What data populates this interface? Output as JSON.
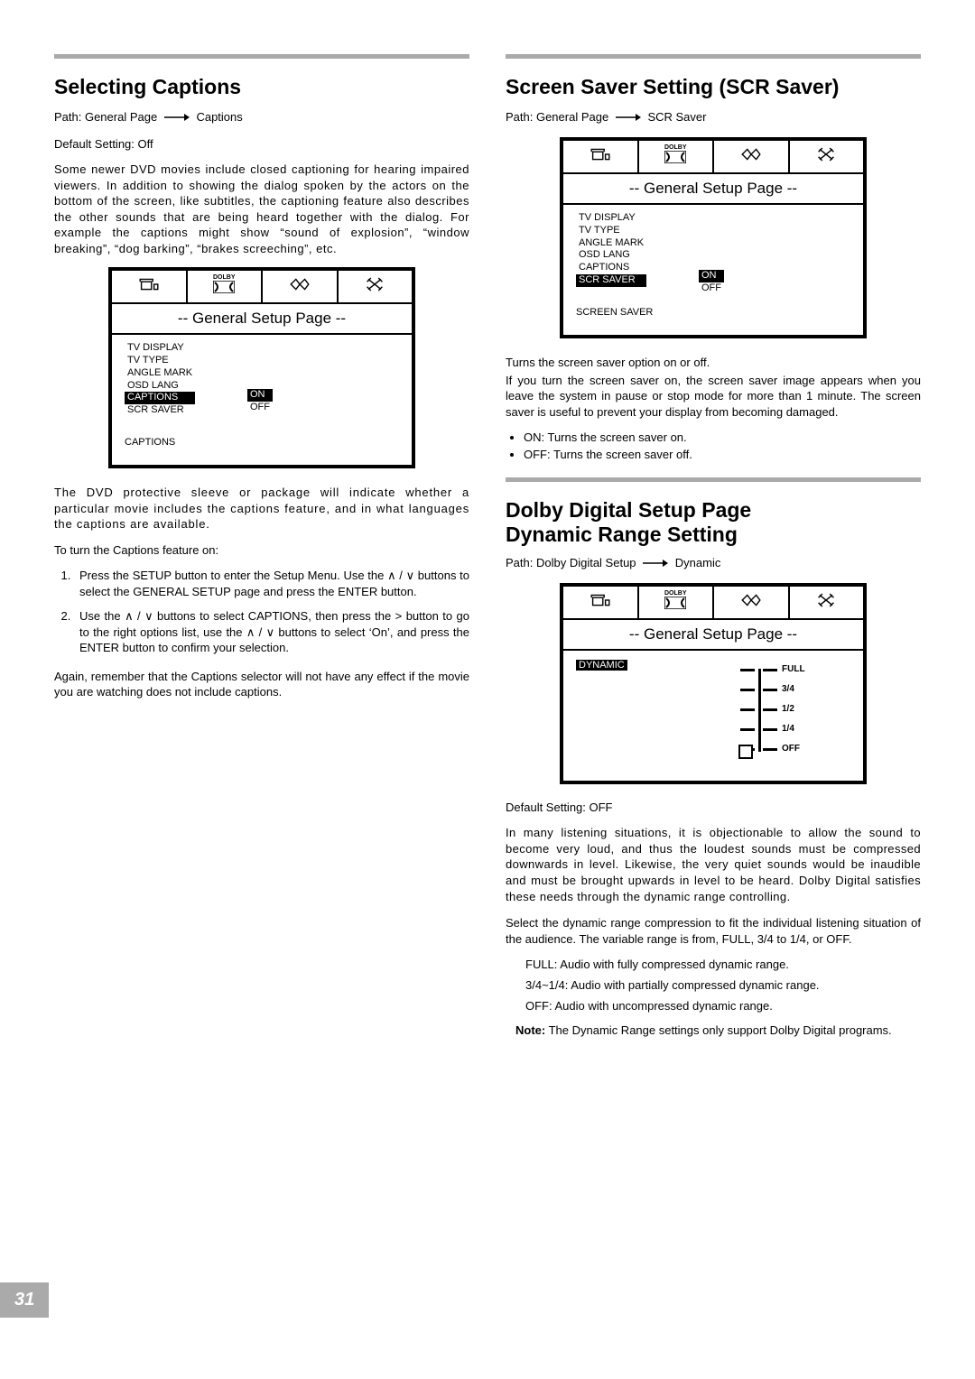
{
  "page_number": "31",
  "left": {
    "heading": "Selecting Captions",
    "path_prefix": "Path: General Page",
    "path_suffix": "Captions",
    "default": "Default Setting: Off",
    "intro": "Some newer DVD movies include closed captioning for hearing impaired viewers. In addition to showing the dialog spoken by the actors on the bottom of the screen, like subtitles, the captioning feature also describes the other sounds that are being heard together with the dialog. For example the captions might show “sound of explosion”, “window breaking”, “dog barking”, “brakes screeching”, etc.",
    "osd_title": "-- General  Setup  Page --",
    "osd_items": [
      "TV DISPLAY",
      "TV TYPE",
      "ANGLE MARK",
      "OSD LANG",
      "CAPTIONS",
      "SCR SAVER"
    ],
    "osd_values": [
      "ON",
      "OFF"
    ],
    "osd_footer": "CAPTIONS",
    "after1": "The DVD protective sleeve or package will indicate whether a particular movie includes the captions feature, and in what languages the captions are available.",
    "after2": "To turn the Captions feature on:",
    "step1a": "Press the SETUP button to enter the Setup Menu. Use the ",
    "step1b": " buttons to select the GENERAL SETUP page and press the ENTER button.",
    "step2a": "Use the ",
    "step2b": " buttons to select CAPTIONS, then press the > button to go to the right options list, use the ",
    "step2c": " buttons to select ‘On’, and press the ENTER button to confirm your selection.",
    "after3": "Again, remember that the Captions selector will not have any effect if the movie you are watching does not include captions."
  },
  "right_a": {
    "heading": "Screen Saver Setting (SCR Saver)",
    "path_prefix": "Path: General Page",
    "path_suffix": "SCR Saver",
    "osd_title": "-- General  Setup  Page --",
    "osd_items": [
      "TV DISPLAY",
      "TV TYPE",
      "ANGLE MARK",
      "OSD LANG",
      "CAPTIONS",
      "SCR SAVER"
    ],
    "osd_values": [
      "ON",
      "OFF"
    ],
    "osd_footer": "SCREEN SAVER",
    "p1": "Turns the screen saver option on or off.",
    "p2": "If you turn the screen saver on, the screen saver image appears when you leave the system in pause or stop mode for more than 1 minute. The screen saver is useful to prevent your display from becoming damaged.",
    "b1": "ON: Turns the screen saver on.",
    "b2": "OFF: Turns the screen saver off."
  },
  "right_b": {
    "heading_l1": "Dolby Digital Setup Page",
    "heading_l2": "Dynamic Range Setting",
    "path_prefix": "Path: Dolby Digital Setup",
    "path_suffix": "Dynamic",
    "osd_title": "-- General  Setup  Page --",
    "osd_item": "DYNAMIC",
    "slider_labels": [
      "FULL",
      "3/4",
      "1/2",
      "1/4",
      "OFF"
    ],
    "default": "Default Setting: OFF",
    "p1": "In many listening situations, it is objectionable to allow the sound to become very loud, and thus the loudest sounds must be compressed downwards in level. Likewise, the very quiet sounds would be inaudible and must be brought upwards in level to be heard. Dolby Digital satisfies these needs through the dynamic range controlling.",
    "p2": "Select the dynamic range compression to fit the individual listening situation of the audience. The variable range is from, FULL, 3/4 to 1/4, or OFF.",
    "i1": "FULL: Audio with fully compressed dynamic range.",
    "i2": "3/4~1/4: Audio with partially compressed dynamic range.",
    "i3": "OFF: Audio with uncompressed dynamic range.",
    "note_label": "Note:",
    "note": "The Dynamic Range settings only support Dolby Digital programs."
  },
  "icons": {
    "dolby_label": "DOLBY"
  }
}
